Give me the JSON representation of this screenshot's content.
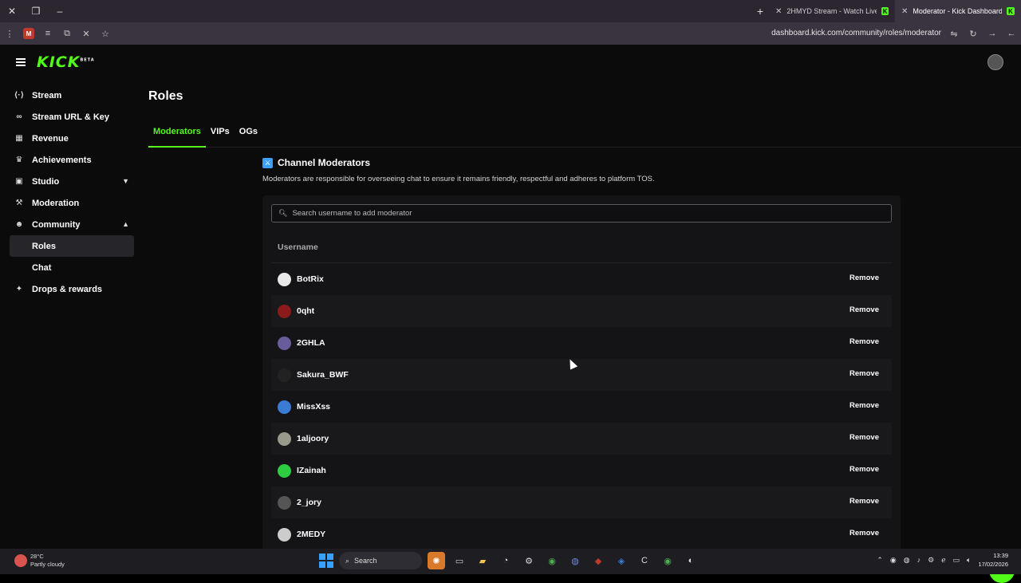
{
  "browser": {
    "tabs": [
      {
        "title": "2HMYD Stream - Watch Live on"
      },
      {
        "title": "Moderator - Kick Dashboard"
      }
    ],
    "url": "dashboard.kick.com/community/roles/moderator",
    "ext_badge": "M"
  },
  "app": {
    "logo": "KICK",
    "logo_badge": "BETA"
  },
  "sidebar": {
    "items": [
      {
        "label": "Stream",
        "icon": "broadcast-icon"
      },
      {
        "label": "Stream URL & Key",
        "icon": "link-icon"
      },
      {
        "label": "Revenue",
        "icon": "revenue-icon"
      },
      {
        "label": "Achievements",
        "icon": "trophy-icon"
      },
      {
        "label": "Studio",
        "icon": "studio-icon"
      },
      {
        "label": "Moderation",
        "icon": "hammer-icon"
      },
      {
        "label": "Community",
        "icon": "community-icon"
      },
      {
        "label": "Drops & rewards",
        "icon": "gift-icon"
      }
    ],
    "community_sub": [
      {
        "label": "Roles"
      },
      {
        "label": "Chat"
      }
    ]
  },
  "main": {
    "title": "Roles",
    "tabs": [
      {
        "label": "Moderators"
      },
      {
        "label": "VIPs"
      },
      {
        "label": "OGs"
      }
    ],
    "section_title": "Channel Moderators",
    "section_desc": "Moderators are responsible for overseeing chat to ensure it remains friendly, respectful and adheres to platform TOS.",
    "search_placeholder": "Search username to add moderator",
    "column_header": "Username",
    "remove_label": "Remove",
    "moderators": [
      {
        "name": "BotRix",
        "color": "#e8e8e8"
      },
      {
        "name": "0qht",
        "color": "#8b1a1a"
      },
      {
        "name": "2GHLA",
        "color": "#6a5c9a"
      },
      {
        "name": "Sakura_BWF",
        "color": "#222222"
      },
      {
        "name": "MissXss",
        "color": "#3a7bd5"
      },
      {
        "name": "1aljoory",
        "color": "#9a9a8a"
      },
      {
        "name": "IZainah",
        "color": "#2ecc40"
      },
      {
        "name": "2_jory",
        "color": "#555555"
      },
      {
        "name": "2MEDY",
        "color": "#cccccc"
      }
    ]
  },
  "taskbar": {
    "temp": "28°C",
    "weather": "Partly cloudy",
    "search": "Search",
    "time": "13:39",
    "date": "17/02/2026"
  },
  "colors": {
    "accent": "#53fc18",
    "background": "#0b0b0c"
  }
}
